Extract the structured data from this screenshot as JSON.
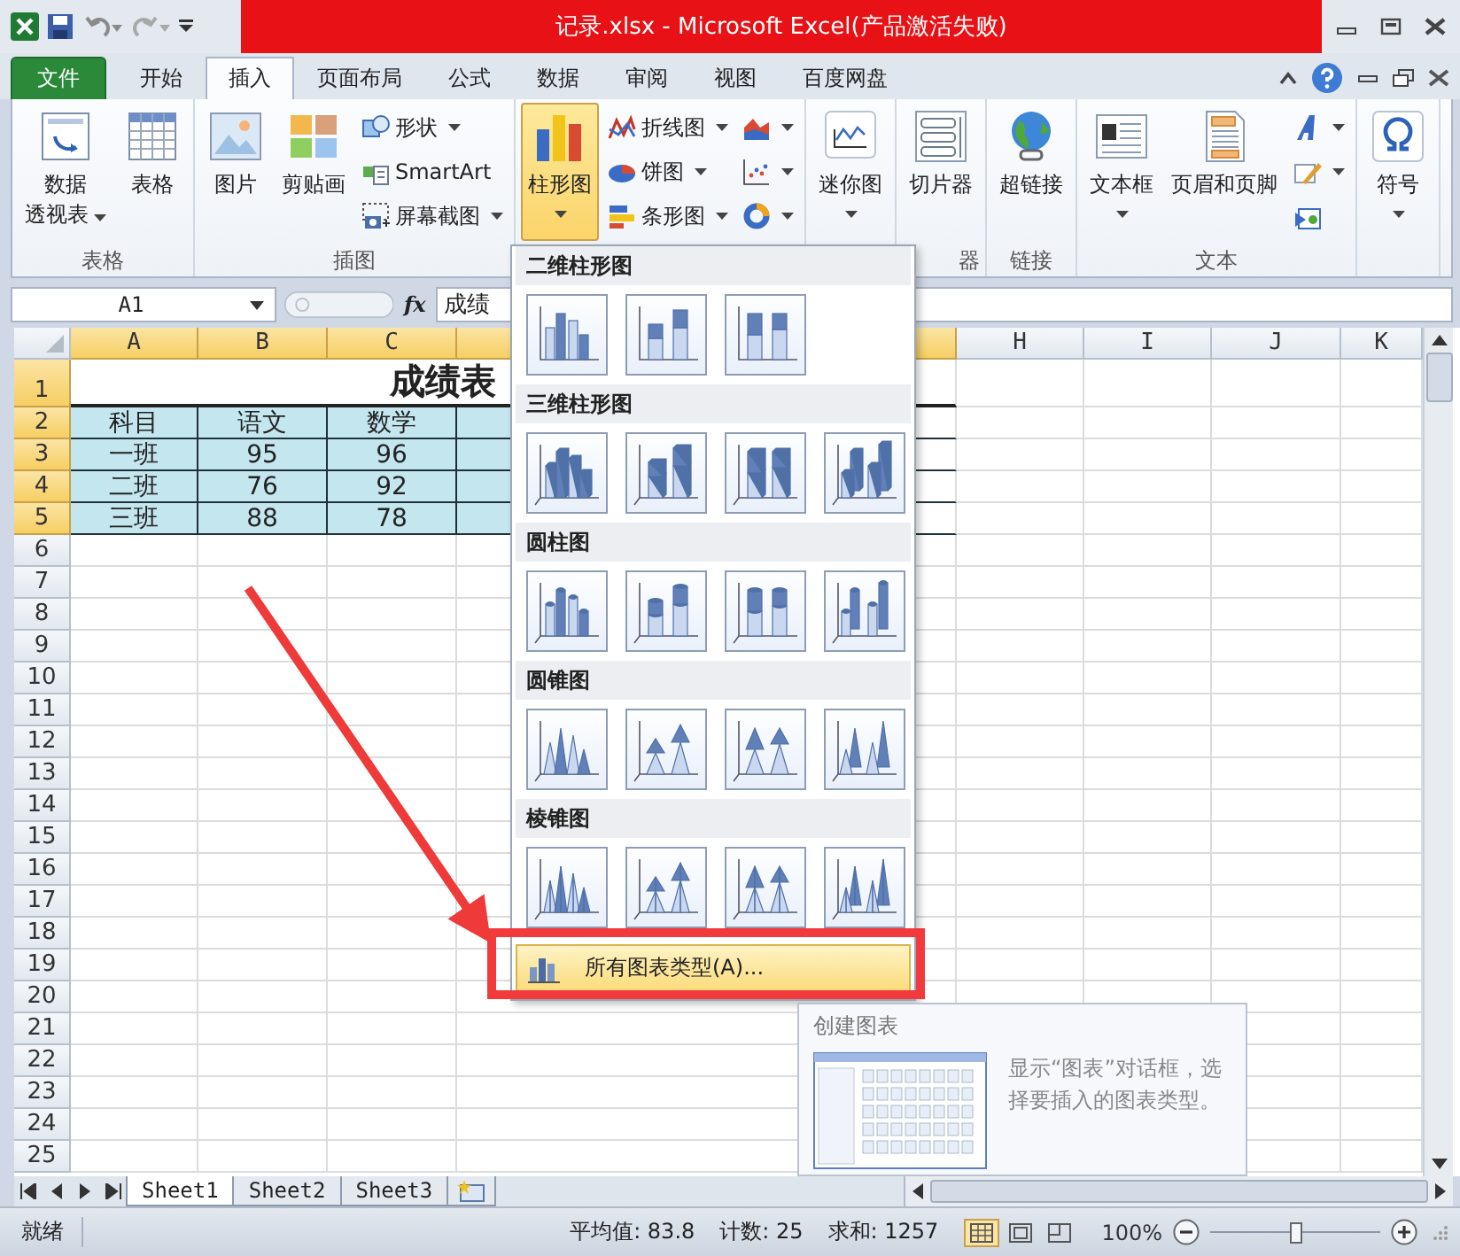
{
  "window": {
    "title": "记录.xlsx - Microsoft Excel(产品激活失败)"
  },
  "tabs": [
    {
      "label": "文件",
      "kind": "file",
      "selected": false
    },
    {
      "label": "开始",
      "kind": "tab",
      "selected": false
    },
    {
      "label": "插入",
      "kind": "tab",
      "selected": true
    },
    {
      "label": "页面布局",
      "kind": "tab",
      "selected": false
    },
    {
      "label": "公式",
      "kind": "tab",
      "selected": false
    },
    {
      "label": "数据",
      "kind": "tab",
      "selected": false
    },
    {
      "label": "审阅",
      "kind": "tab",
      "selected": false
    },
    {
      "label": "视图",
      "kind": "tab",
      "selected": false
    },
    {
      "label": "百度网盘",
      "kind": "tab",
      "selected": false
    }
  ],
  "ribbon_groups": [
    {
      "label": "表格",
      "buttons": [
        {
          "kind": "large",
          "lines": [
            "数据",
            "透视表"
          ],
          "dropdown": true,
          "pressed": false
        },
        {
          "kind": "large",
          "label": "表格",
          "dropdown": false,
          "pressed": false
        }
      ]
    },
    {
      "label": "插图",
      "buttons": [
        {
          "kind": "large",
          "label": "图片",
          "dropdown": false,
          "pressed": false
        },
        {
          "kind": "large",
          "label": "剪贴画",
          "dropdown": false,
          "pressed": false
        },
        {
          "kind": "small",
          "label": "形状",
          "dropdown": true,
          "pressed": false
        },
        {
          "kind": "small",
          "label": "SmartArt",
          "dropdown": false,
          "pressed": false
        },
        {
          "kind": "small",
          "label": "屏幕截图",
          "dropdown": true,
          "pressed": false
        }
      ]
    },
    {
      "buttons": [
        {
          "kind": "large",
          "label": "柱形图",
          "dropdown": true,
          "pressed": true
        },
        {
          "kind": "small",
          "label": "折线图",
          "dropdown": true,
          "pressed": false
        },
        {
          "kind": "small",
          "label": "饼图",
          "dropdown": true,
          "pressed": false
        },
        {
          "kind": "small",
          "label": "条形图",
          "dropdown": true,
          "pressed": false
        },
        {
          "kind": "small",
          "dropdown": true,
          "pressed": false
        },
        {
          "kind": "small",
          "dropdown": true,
          "pressed": false
        },
        {
          "kind": "small",
          "dropdown": true,
          "pressed": false
        }
      ]
    },
    {
      "buttons": [
        {
          "kind": "large",
          "label": "迷你图",
          "dropdown": true,
          "pressed": false
        }
      ]
    },
    {
      "label": "器",
      "buttons": [
        {
          "kind": "large",
          "label": "切片器",
          "dropdown": false,
          "pressed": false
        }
      ]
    },
    {
      "label": "链接",
      "buttons": [
        {
          "kind": "large",
          "label": "超链接",
          "dropdown": false,
          "pressed": false
        }
      ]
    },
    {
      "label": "文本",
      "buttons": [
        {
          "kind": "large",
          "label": "文本框",
          "dropdown": true,
          "pressed": false
        },
        {
          "kind": "large",
          "label": "页眉和页脚",
          "dropdown": false,
          "pressed": false
        },
        {
          "kind": "small",
          "dropdown": true,
          "pressed": false
        },
        {
          "kind": "small",
          "dropdown": true,
          "pressed": false
        },
        {
          "kind": "small",
          "dropdown": false,
          "pressed": false
        }
      ]
    },
    {
      "buttons": [
        {
          "kind": "large",
          "label": "符号",
          "dropdown": true,
          "pressed": false
        }
      ]
    }
  ],
  "chart_menu": {
    "sections": [
      {
        "heading": "二维柱形图",
        "kind": "column",
        "items": [
          {
            "kind": "clustered"
          },
          {
            "kind": "stacked"
          },
          {
            "kind": "percent"
          }
        ]
      },
      {
        "heading": "三维柱形图",
        "kind": "column3d",
        "items": [
          {
            "kind": "clustered"
          },
          {
            "kind": "stacked"
          },
          {
            "kind": "percent"
          },
          {
            "kind": "deep"
          }
        ]
      },
      {
        "heading": "圆柱图",
        "kind": "cylinder",
        "items": [
          {
            "kind": "clustered"
          },
          {
            "kind": "stacked"
          },
          {
            "kind": "percent"
          },
          {
            "kind": "deep"
          }
        ]
      },
      {
        "heading": "圆锥图",
        "kind": "cone",
        "items": [
          {
            "kind": "clustered"
          },
          {
            "kind": "stacked"
          },
          {
            "kind": "percent"
          },
          {
            "kind": "deep"
          }
        ]
      },
      {
        "heading": "棱锥图",
        "kind": "pyramid",
        "items": [
          {
            "kind": "clustered"
          },
          {
            "kind": "stacked"
          },
          {
            "kind": "percent"
          },
          {
            "kind": "deep"
          }
        ]
      }
    ],
    "footer": {
      "label": "所有图表类型(A)...",
      "highlighted": true
    }
  },
  "formula_bar": {
    "name_box": "A1",
    "function_button": "fx",
    "formula": "成绩"
  },
  "sheet": {
    "columns": [
      {
        "kind": "column",
        "label": "A",
        "selected": true
      },
      {
        "kind": "column",
        "label": "B",
        "selected": true
      },
      {
        "kind": "column",
        "label": "C",
        "selected": true
      },
      {
        "kind": "covered",
        "selected": true
      },
      {
        "kind": "column",
        "label": "H",
        "selected": false
      },
      {
        "kind": "column",
        "label": "I",
        "selected": false
      },
      {
        "kind": "column",
        "label": "J",
        "selected": false
      },
      {
        "kind": "column",
        "label": "K",
        "selected": false
      }
    ],
    "rows": [
      {
        "number": "1",
        "kind": "title",
        "selected": true,
        "cells": [
          "成绩表"
        ]
      },
      {
        "number": "2",
        "kind": "table",
        "selected": true,
        "cells": [
          "科目",
          "语文",
          "数学"
        ]
      },
      {
        "number": "3",
        "kind": "table",
        "selected": true,
        "cells": [
          "一班",
          "95",
          "96"
        ]
      },
      {
        "number": "4",
        "kind": "table",
        "selected": true,
        "cells": [
          "二班",
          "76",
          "92"
        ]
      },
      {
        "number": "5",
        "kind": "table",
        "selected": true,
        "cells": [
          "三班",
          "88",
          "78"
        ]
      },
      {
        "number": "6",
        "kind": "blank",
        "selected": false
      },
      {
        "number": "7",
        "kind": "blank",
        "selected": false
      },
      {
        "number": "8",
        "kind": "blank",
        "selected": false
      },
      {
        "number": "9",
        "kind": "blank",
        "selected": false
      },
      {
        "number": "10",
        "kind": "blank",
        "selected": false
      },
      {
        "number": "11",
        "kind": "blank",
        "selected": false
      },
      {
        "number": "12",
        "kind": "blank",
        "selected": false
      },
      {
        "number": "13",
        "kind": "blank",
        "selected": false
      },
      {
        "number": "14",
        "kind": "blank",
        "selected": false
      },
      {
        "number": "15",
        "kind": "blank",
        "selected": false
      },
      {
        "number": "16",
        "kind": "blank",
        "selected": false
      },
      {
        "number": "17",
        "kind": "blank",
        "selected": false
      },
      {
        "number": "18",
        "kind": "blank",
        "selected": false
      },
      {
        "number": "19",
        "kind": "blank",
        "selected": false
      },
      {
        "number": "20",
        "kind": "blank",
        "selected": false
      },
      {
        "number": "21",
        "kind": "blank",
        "selected": false
      },
      {
        "number": "22",
        "kind": "blank",
        "selected": false
      },
      {
        "number": "23",
        "kind": "blank",
        "selected": false
      },
      {
        "number": "24",
        "kind": "blank",
        "selected": false
      },
      {
        "number": "25",
        "kind": "blank",
        "selected": false
      }
    ]
  },
  "sheet_tabs": [
    {
      "label": "Sheet1",
      "selected": true
    },
    {
      "label": "Sheet2",
      "selected": false
    },
    {
      "label": "Sheet3",
      "selected": false
    }
  ],
  "status_bar": {
    "ready": "就绪",
    "average": "平均值: 83.8",
    "count": "计数: 25",
    "sum": "求和: 1257",
    "views": [
      {
        "kind": "normal",
        "selected": true
      },
      {
        "kind": "layout",
        "selected": false
      },
      {
        "kind": "pagebreak",
        "selected": false
      }
    ],
    "zoom": "100%",
    "zoom_slider": {
      "level": 0.5
    }
  },
  "tooltip": {
    "title": "创建图表",
    "text": "显示“图表”对话框，选择要插入的图表类型。"
  }
}
